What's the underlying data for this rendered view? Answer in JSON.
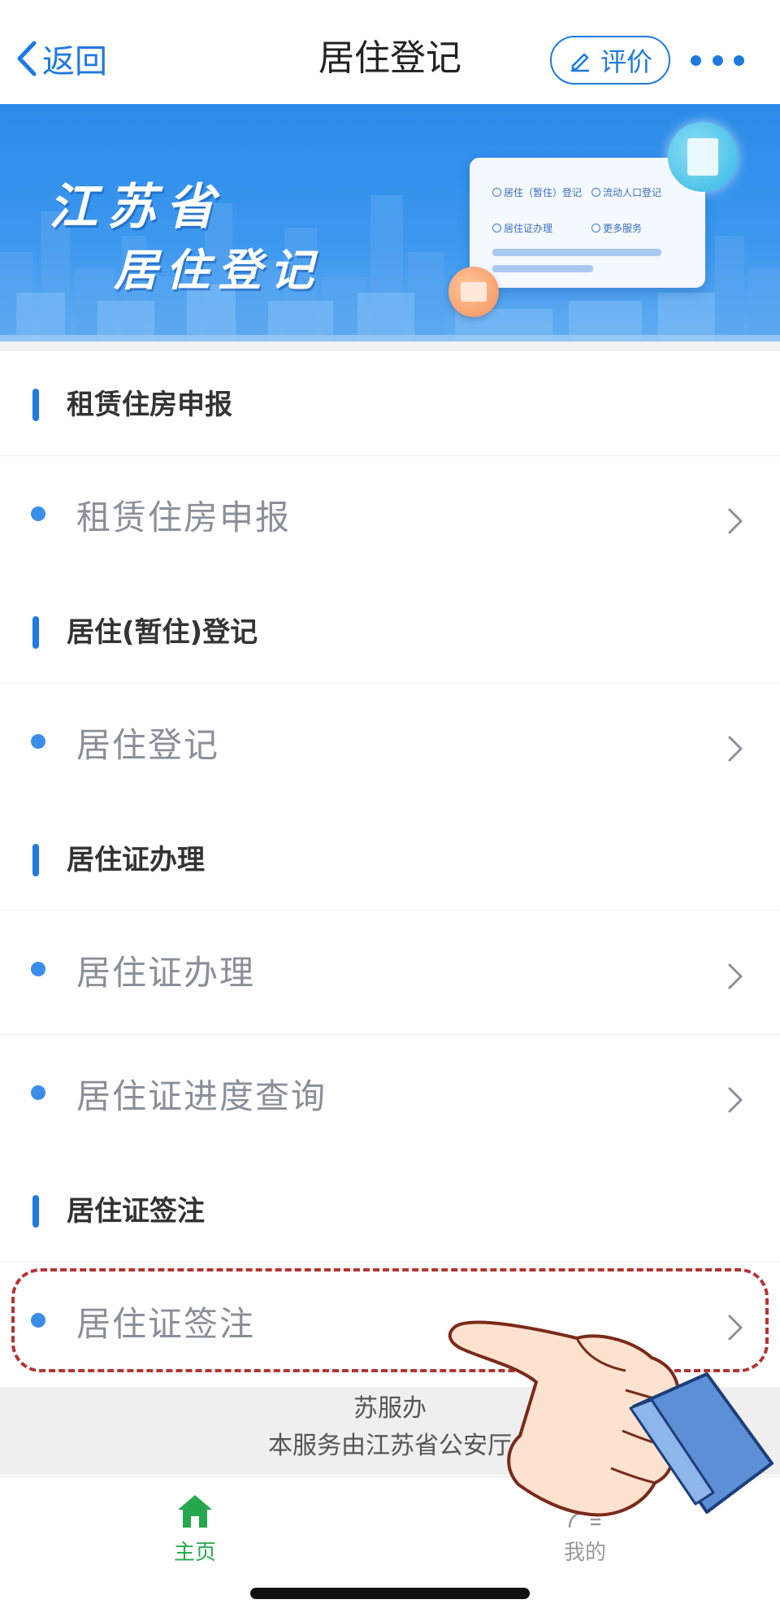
{
  "nav": {
    "back_label": "返回",
    "title": "居住登记",
    "rate_label": "评价"
  },
  "banner": {
    "line1": "江苏省",
    "line2": "居住登记",
    "card_options": [
      "居住（暂住）登记",
      "流动人口登记",
      "居住证办理",
      "更多服务"
    ]
  },
  "sections": [
    {
      "title": "租赁住房申报",
      "items": [
        "租赁住房申报"
      ]
    },
    {
      "title": "居住(暂住)登记",
      "items": [
        "居住登记"
      ]
    },
    {
      "title": "居住证办理",
      "items": [
        "居住证办理",
        "居住证进度查询"
      ]
    },
    {
      "title": "居住证签注",
      "items": [
        "居住证签注"
      ]
    }
  ],
  "footer": {
    "line1": "苏服办",
    "line2": "本服务由江苏省公安厅"
  },
  "tabs": {
    "home": "主页",
    "me": "我的"
  },
  "colors": {
    "accent": "#1f7ae0",
    "tab_active": "#27a84f",
    "highlight": "#b33434"
  }
}
